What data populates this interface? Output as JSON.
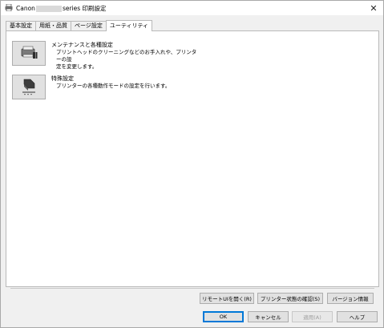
{
  "window": {
    "title_prefix": "Canon",
    "title_suffix": "series 印刷設定",
    "close_glyph": "✕"
  },
  "tabs": [
    {
      "label": "基本設定",
      "active": false
    },
    {
      "label": "用紙・品質",
      "active": false
    },
    {
      "label": "ページ設定",
      "active": false
    },
    {
      "label": "ユーティリティ",
      "active": true
    }
  ],
  "features": [
    {
      "title": "メンテナンスと各種設定",
      "description": "プリントヘッドのクリーニングなどのお手入れや、プリンターの設\n定を変更します。",
      "icon": "printer-maintenance-icon"
    },
    {
      "title": "特殊設定",
      "description": "プリンターの各種動作モードの設定を行います。",
      "icon": "special-settings-icon"
    }
  ],
  "utility_buttons": {
    "remote_ui": "リモートUIを開く(R)",
    "printer_status": "プリンター状態の確認(S)",
    "version_info": "バージョン情報"
  },
  "dialog_buttons": {
    "ok": "OK",
    "cancel": "キャンセル",
    "apply": "適用(A)",
    "help": "ヘルプ"
  }
}
